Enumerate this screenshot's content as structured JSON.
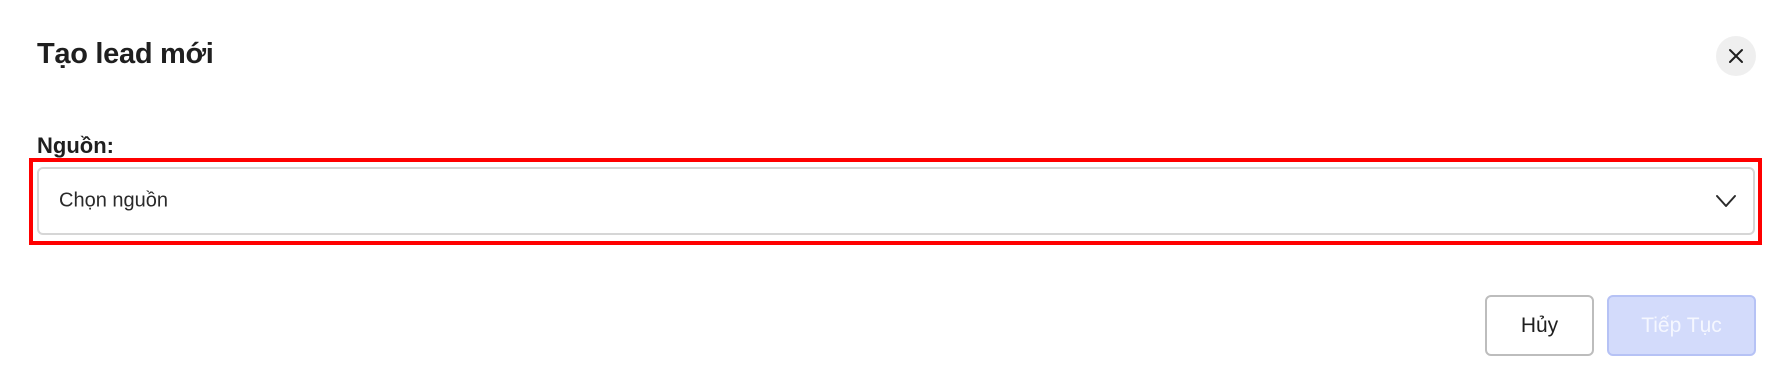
{
  "dialog": {
    "title": "Tạo lead mới",
    "close_icon": "close-icon"
  },
  "form": {
    "source_label": "Nguồn:",
    "source_select": {
      "placeholder": "Chọn nguồn",
      "chevron_icon": "chevron-down-icon"
    }
  },
  "actions": {
    "cancel_label": "Hủy",
    "continue_label": "Tiếp Tục"
  },
  "colors": {
    "highlight": "#ff0000",
    "continue_bg_disabled": "#d3dbfb",
    "continue_text_disabled": "#f5f7ff",
    "close_bg": "#efefef"
  }
}
